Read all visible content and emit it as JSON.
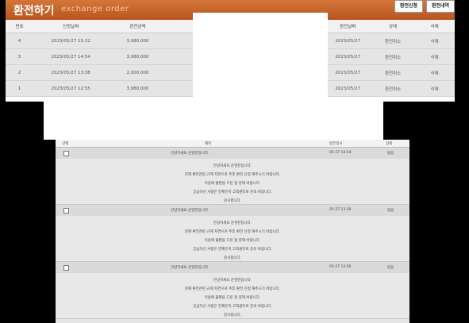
{
  "exchange": {
    "title": "환전하기",
    "subtitle": "exchange order",
    "buttons": {
      "apply": "환전신청",
      "history": "환전내역"
    },
    "columns": [
      "번호",
      "신청날짜",
      "환전금액",
      "환전날짜",
      "상태",
      "삭제"
    ],
    "rows": [
      {
        "no": "4",
        "date": "2023/05/27 15:22",
        "amount": "3,980,000",
        "exdate": "2023/05/27",
        "status": "환전취소",
        "del": "삭제"
      },
      {
        "no": "3",
        "date": "2023/05/27 14:54",
        "amount": "3,980,000",
        "exdate": "2023/05/27",
        "status": "환전취소",
        "del": "삭제"
      },
      {
        "no": "2",
        "date": "2023/05/27 13:38",
        "amount": "2,000,000",
        "exdate": "2023/05/27",
        "status": "환전취소",
        "del": "삭제"
      },
      {
        "no": "1",
        "date": "2023/05/27 12:55",
        "amount": "3,980,000",
        "exdate": "2023/05/27",
        "status": "환전취소",
        "del": "삭제"
      }
    ]
  },
  "notice": {
    "columns": [
      "선택",
      "제목",
      "받은일시",
      "상태"
    ],
    "items": [
      {
        "title": "안녕하세요 운영진입니다.",
        "date": "05-27 14:54",
        "status": "읽음",
        "body": [
          "안녕하세요 운영진입니다.",
          "현재 환전관련 규제 자연으로 추후 환전 신청 해주시기 바랍니다.",
          "이용에 불편을 드린 점 양해 바랍니다.",
          "궁금하신 사항은 언제든지 고객센터로 문의 바랍니다.",
          "감사합니다."
        ]
      },
      {
        "title": "안녕하세요 운영진입니다.",
        "date": "05-27 13:39",
        "status": "읽음",
        "body": [
          "안녕하세요 운영진입니다.",
          "현재 환전관련 규제 자연으로 추후 환전 신청 해주시기 바랍니다.",
          "이용에 불편을 드린 점 양해 바랍니다.",
          "궁금하신 사항은 언제든지 고객센터로 문의 바랍니다.",
          "감사합니다."
        ]
      },
      {
        "title": "안녕하세요 운영진입니다.",
        "date": "05-27 12:56",
        "status": "읽음",
        "body": [
          "안녕하세요 운영진입니다.",
          "현재 환전관련 규제 자연으로 추후 환전 신청 해주시기 바랍니다.",
          "이용에 불편을 드린 점 양해 바랍니다.",
          "궁금하신 사항은 언제든지 고객센터로 문의 바랍니다.",
          "감사합니다."
        ]
      }
    ]
  },
  "colors": {
    "header": "#c4612a",
    "background": "#000000"
  }
}
